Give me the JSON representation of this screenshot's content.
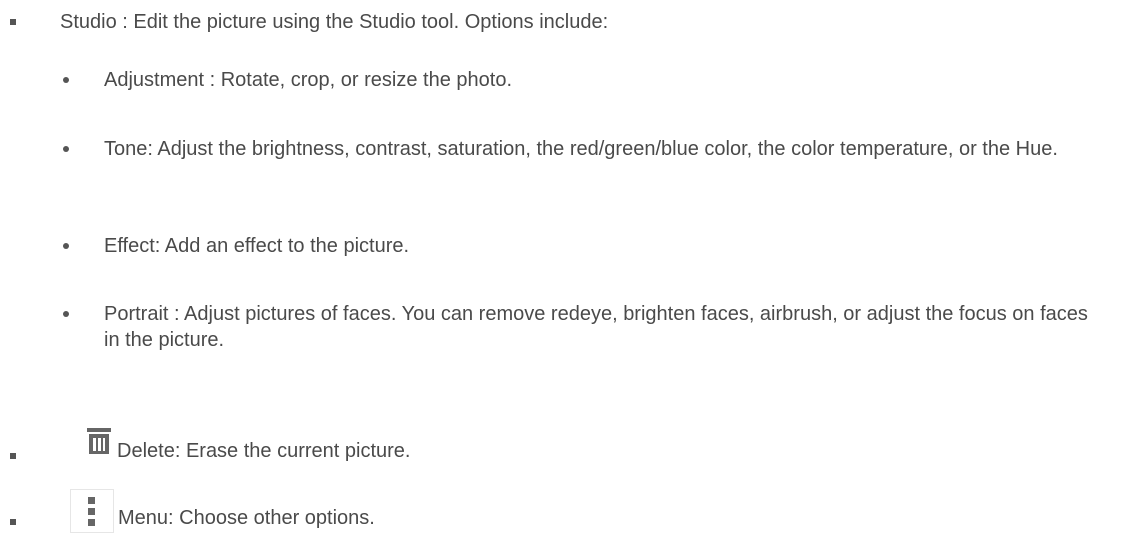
{
  "items": [
    {
      "label": "Studio",
      "separator": " : ",
      "description": "Edit the picture using the Studio tool. Options include:",
      "sub_items": [
        {
          "label": "Adjustment",
          "separator": "  : ",
          "description": "Rotate, crop, or resize the photo."
        },
        {
          "label": "Tone",
          "separator": ": ",
          "description": "Adjust the brightness, contrast, saturation, the red/green/blue color, the color temperature, or the Hue."
        },
        {
          "label": "Effect",
          "separator": ": ",
          "description": "Add an effect to the picture."
        },
        {
          "label": "Portrait",
          "separator": " : ",
          "description": "Adjust pictures of faces. You can remove redeye, brighten faces, airbrush, or adjust the focus on faces in the picture."
        }
      ]
    },
    {
      "icon": "trash-icon",
      "label": "Delete",
      "separator": ": ",
      "description": "Erase the current picture."
    },
    {
      "icon": "more-vertical-icon",
      "label": "Menu",
      "separator": ": ",
      "description": "Choose other options."
    }
  ]
}
